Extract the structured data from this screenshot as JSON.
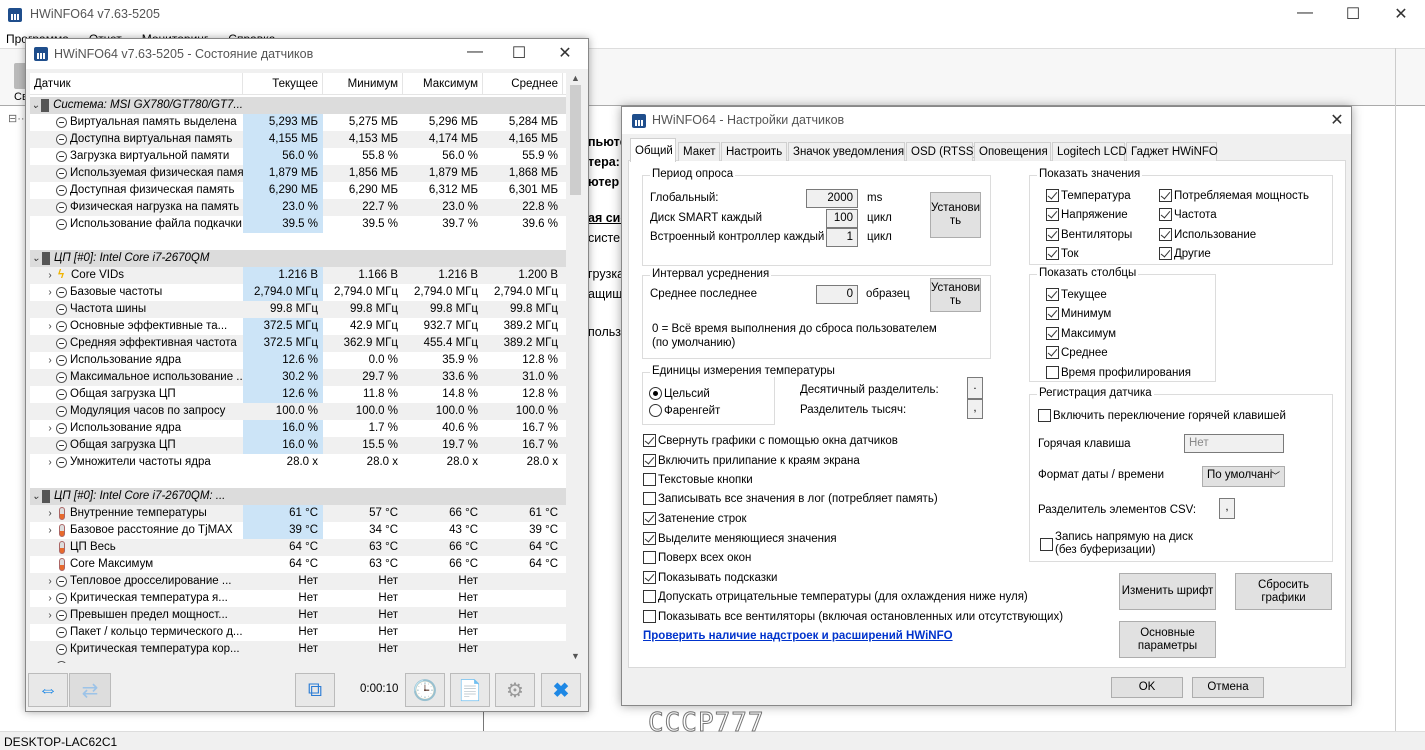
{
  "main": {
    "title": "HWiNFO64 v7.63-5205",
    "menu": [
      "Программа",
      "Отчет",
      "Мониторинг",
      "Справка"
    ],
    "toolbar_label": "Св",
    "status": "DESKTOP-LAC62C1",
    "fragments": [
      {
        "t": "пьюте",
        "b": true
      },
      {
        "t": "тера:",
        "b": true
      },
      {
        "t": "ютер",
        "b": true
      },
      {
        "t": "ая сис",
        "b": true,
        "u": true
      },
      {
        "t": "систе"
      },
      {
        "t": "грузка"
      },
      {
        "t": "ащище"
      },
      {
        "t": "пользо"
      }
    ]
  },
  "sensors": {
    "title": "HWiNFO64 v7.63-5205 - Состояние датчиков",
    "columns": [
      "Датчик",
      "Текущее",
      "Минимум",
      "Максимум",
      "Среднее"
    ],
    "rows": [
      {
        "g": true,
        "name": "Система: MSI GX780/GT780/GT7..."
      },
      {
        "i": "gauge",
        "name": "Виртуальная память выделена",
        "v": [
          "5,293 МБ",
          "5,275 МБ",
          "5,296 МБ",
          "5,284 МБ"
        ],
        "hl": true
      },
      {
        "i": "gauge",
        "name": "Доступна виртуальная память",
        "v": [
          "4,155 МБ",
          "4,153 МБ",
          "4,174 МБ",
          "4,165 МБ"
        ],
        "hl": true
      },
      {
        "i": "gauge",
        "name": "Загрузка виртуальной памяти",
        "v": [
          "56.0 %",
          "55.8 %",
          "56.0 %",
          "55.9 %"
        ],
        "hl": true
      },
      {
        "i": "gauge",
        "name": "Используемая физическая память",
        "v": [
          "1,879 МБ",
          "1,856 МБ",
          "1,879 МБ",
          "1,868 МБ"
        ],
        "hl": true
      },
      {
        "i": "gauge",
        "name": "Доступная физическая память",
        "v": [
          "6,290 МБ",
          "6,290 МБ",
          "6,312 МБ",
          "6,301 МБ"
        ],
        "hl": true
      },
      {
        "i": "gauge",
        "name": "Физическая нагрузка на память",
        "v": [
          "23.0 %",
          "22.7 %",
          "23.0 %",
          "22.8 %"
        ],
        "hl": true
      },
      {
        "i": "gauge",
        "name": "Использование файла подкачки",
        "v": [
          "39.5 %",
          "39.5 %",
          "39.7 %",
          "39.6 %"
        ],
        "hl": true
      },
      {
        "blank": true
      },
      {
        "g": true,
        "name": "ЦП [#0]: Intel Core i7-2670QM"
      },
      {
        "x": true,
        "i": "bolt",
        "name": "Core VIDs",
        "v": [
          "1.216 В",
          "1.166 В",
          "1.216 В",
          "1.200 В"
        ],
        "hl": true
      },
      {
        "x": true,
        "i": "gauge",
        "name": "Базовые частоты",
        "v": [
          "2,794.0 МГц",
          "2,794.0 МГц",
          "2,794.0 МГц",
          "2,794.0 МГц"
        ],
        "hl": true
      },
      {
        "i": "gauge",
        "name": "Частота шины",
        "v": [
          "99.8 МГц",
          "99.8 МГц",
          "99.8 МГц",
          "99.8 МГц"
        ]
      },
      {
        "x": true,
        "i": "gauge",
        "name": "Основные эффективные та...",
        "v": [
          "372.5 МГц",
          "42.9 МГц",
          "932.7 МГц",
          "389.2 МГц"
        ],
        "hl": true
      },
      {
        "i": "gauge",
        "name": "Средняя эффективная частота",
        "v": [
          "372.5 МГц",
          "362.9 МГц",
          "455.4 МГц",
          "389.2 МГц"
        ],
        "hl": true
      },
      {
        "x": true,
        "i": "gauge",
        "name": "Использование ядра",
        "v": [
          "12.6 %",
          "0.0 %",
          "35.9 %",
          "12.8 %"
        ],
        "hl": true
      },
      {
        "i": "gauge",
        "name": "Максимальное использование ...",
        "v": [
          "30.2 %",
          "29.7 %",
          "33.6 %",
          "31.0 %"
        ],
        "hl": true
      },
      {
        "i": "gauge",
        "name": "Общая загрузка ЦП",
        "v": [
          "12.6 %",
          "11.8 %",
          "14.8 %",
          "12.8 %"
        ],
        "hl": true
      },
      {
        "i": "gauge",
        "name": "Модуляция часов по запросу",
        "v": [
          "100.0 %",
          "100.0 %",
          "100.0 %",
          "100.0 %"
        ]
      },
      {
        "x": true,
        "i": "gauge",
        "name": "Использование ядра",
        "v": [
          "16.0 %",
          "1.7 %",
          "40.6 %",
          "16.7 %"
        ],
        "hl": true
      },
      {
        "i": "gauge",
        "name": "Общая загрузка ЦП",
        "v": [
          "16.0 %",
          "15.5 %",
          "19.7 %",
          "16.7 %"
        ],
        "hl": true
      },
      {
        "x": true,
        "i": "gauge",
        "name": "Умножители частоты ядра",
        "v": [
          "28.0 x",
          "28.0 x",
          "28.0 x",
          "28.0 x"
        ]
      },
      {
        "blank": true
      },
      {
        "g": true,
        "name": "ЦП [#0]: Intel Core i7-2670QM: ..."
      },
      {
        "x": true,
        "i": "therm",
        "name": "Внутренние температуры",
        "v": [
          "61 °C",
          "57 °C",
          "66 °C",
          "61 °C"
        ],
        "hl": true
      },
      {
        "x": true,
        "i": "therm",
        "name": "Базовое расстояние до TjMAX",
        "v": [
          "39 °C",
          "34 °C",
          "43 °C",
          "39 °C"
        ],
        "hl": true
      },
      {
        "i": "therm",
        "name": "ЦП Весь",
        "v": [
          "64 °C",
          "63 °C",
          "66 °C",
          "64 °C"
        ]
      },
      {
        "i": "therm",
        "name": "Core Максимум",
        "v": [
          "64 °C",
          "63 °C",
          "66 °C",
          "64 °C"
        ]
      },
      {
        "x": true,
        "i": "gauge",
        "name": "Тепловое дросселирование ...",
        "v": [
          "Нет",
          "Нет",
          "Нет",
          ""
        ]
      },
      {
        "x": true,
        "i": "gauge",
        "name": "Критическая температура я...",
        "v": [
          "Нет",
          "Нет",
          "Нет",
          ""
        ]
      },
      {
        "x": true,
        "i": "gauge",
        "name": "Превышен предел мощност...",
        "v": [
          "Нет",
          "Нет",
          "Нет",
          ""
        ]
      },
      {
        "i": "gauge",
        "name": "Пакет / кольцо термического д...",
        "v": [
          "Нет",
          "Нет",
          "Нет",
          ""
        ]
      },
      {
        "i": "gauge",
        "name": "Критическая температура кор...",
        "v": [
          "Нет",
          "Нет",
          "Нет",
          ""
        ]
      }
    ],
    "timer": "0:00:10",
    "highlight_color": "#cce4f7"
  },
  "settings": {
    "title": "HWiNFO64 - Настройки датчиков",
    "tabs": [
      "Общий",
      "Макет",
      "Настроить",
      "Значок уведомления",
      "OSD (RTSS)",
      "Оповещения",
      "Logitech LCD",
      "Гаджет HWiNFO"
    ],
    "active_tab": "Общий",
    "poll": {
      "legend": "Период опроса",
      "global_label": "Глобальный:",
      "global_value": "2000",
      "global_unit": "ms",
      "smart_label": "Диск SMART каждый",
      "smart_value": "100",
      "smart_unit": "цикл",
      "ec_label": "Встроенный контроллер каждый",
      "ec_value": "1",
      "ec_unit": "цикл",
      "set_button": "Установи ть"
    },
    "avg": {
      "legend": "Интервал усреднения",
      "label": "Среднее последнее",
      "value": "0",
      "unit": "образец",
      "set_button": "Установи ть",
      "note": "0 = Всё время выполнения до сброса пользователем (по умолчанию)"
    },
    "temp_units": {
      "legend": "Единицы измерения температуры",
      "options": [
        "Цельсий",
        "Фаренгейт"
      ],
      "selected": "Цельсий",
      "decimal_label": "Десятичный разделитель:",
      "decimal_value": ".",
      "thousands_label": "Разделитель тысяч:",
      "thousands_value": ","
    },
    "options": [
      {
        "label": "Свернуть графики с помощью окна датчиков",
        "checked": true
      },
      {
        "label": "Включить прилипание к краям экрана",
        "checked": true
      },
      {
        "label": "Текстовые кнопки",
        "checked": false
      },
      {
        "label": "Записывать все значения в лог (потребляет память)",
        "checked": false
      },
      {
        "label": "Затенение строк",
        "checked": true
      },
      {
        "label": "Выделите меняющиеся значения",
        "checked": true
      },
      {
        "label": "Поверх всех окон",
        "checked": false
      },
      {
        "label": "Показывать подсказки",
        "checked": true
      },
      {
        "label": "Допускать отрицательные температуры (для охлаждения ниже нуля)",
        "checked": false
      },
      {
        "label": "Показывать все вентиляторы (включая остановленных или отсутствующих)",
        "checked": false
      }
    ],
    "link": "Проверить наличие надстроек и расширений HWiNFO",
    "show_values": {
      "legend": "Показать значения",
      "items": [
        {
          "label": "Температура",
          "checked": true
        },
        {
          "label": "Напряжение",
          "checked": true
        },
        {
          "label": "Вентиляторы",
          "checked": true
        },
        {
          "label": "Ток",
          "checked": true
        },
        {
          "label": "Потребляемая мощность",
          "checked": true
        },
        {
          "label": "Частота",
          "checked": true
        },
        {
          "label": "Использование",
          "checked": true
        },
        {
          "label": "Другие",
          "checked": true
        }
      ]
    },
    "show_columns": {
      "legend": "Показать столбцы",
      "items": [
        {
          "label": "Текущее",
          "checked": true
        },
        {
          "label": "Минимум",
          "checked": true
        },
        {
          "label": "Максимум",
          "checked": true
        },
        {
          "label": "Среднее",
          "checked": true
        },
        {
          "label": "Время профилирования",
          "checked": false
        }
      ]
    },
    "logging": {
      "legend": "Регистрация датчика",
      "hotkey_toggle": "Включить переключение горячей клавишей",
      "hotkey_toggle_checked": false,
      "hotkey_label": "Горячая клавиша",
      "hotkey_value": "Нет",
      "date_label": "Формат даты / времени",
      "date_value": "По умолчані",
      "csv_label": "Разделитель элементов CSV:",
      "csv_value": ",",
      "direct_label": "Запись напрямую на диск (без буферизации)",
      "direct_checked": false
    },
    "buttons": {
      "font": "Изменить шрифт",
      "reset": "Сбросить графики",
      "main": "Основные параметры",
      "ok": "OK",
      "cancel": "Отмена"
    }
  },
  "watermark": "CCCP777"
}
